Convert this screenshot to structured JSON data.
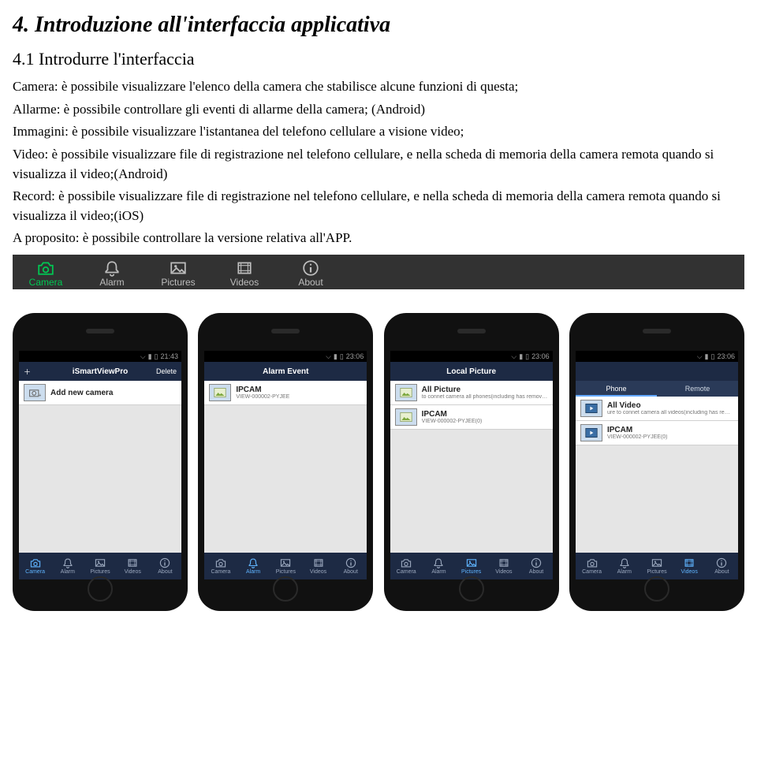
{
  "headings": {
    "h1": "4. Introduzione all'interfaccia applicativa",
    "h2": "4.1 Introdurre l'interfaccia"
  },
  "paragraphs": {
    "p1": "Camera: è possibile visualizzare l'elenco della camera che stabilisce alcune funzioni di questa;",
    "p2": "Allarme: è possibile controllare gli eventi di allarme della camera; (Android)",
    "p3": "Immagini: è possibile visualizzare l'istantanea del telefono cellulare a visione video;",
    "p4": "Video: è possibile visualizzare file di registrazione nel telefono cellulare, e nella scheda di memoria della camera remota quando si visualizza il video;(Android)",
    "p5": "Record: è possibile visualizzare file di registrazione nel telefono cellulare, e nella scheda di memoria della camera remota quando si visualizza il video;(iOS)",
    "p6": "A proposito: è possibile controllare la versione relativa all'APP."
  },
  "toolbar": {
    "items": [
      {
        "icon": "camera-icon",
        "label": "Camera",
        "active": true
      },
      {
        "icon": "bell-icon",
        "label": "Alarm",
        "active": false
      },
      {
        "icon": "image-icon",
        "label": "Pictures",
        "active": false
      },
      {
        "icon": "film-icon",
        "label": "Videos",
        "active": false
      },
      {
        "icon": "info-icon",
        "label": "About",
        "active": false
      }
    ]
  },
  "phones": [
    {
      "status_time": "21:43",
      "appbar": {
        "left": "＋",
        "center": "iSmartViewPro",
        "right": "Delete"
      },
      "tabs": null,
      "rows": [
        {
          "thumb": "camera-add",
          "t1": "Add new camera",
          "t2": ""
        }
      ],
      "bottomnav_active": 0
    },
    {
      "status_time": "23:06",
      "appbar": {
        "left": "",
        "center": "Alarm Event",
        "right": ""
      },
      "tabs": null,
      "rows": [
        {
          "thumb": "photo",
          "t1": "IPCAM",
          "t2": "VIEW-000002-PYJEE"
        }
      ],
      "bottomnav_active": 1
    },
    {
      "status_time": "23:06",
      "appbar": {
        "left": "",
        "center": "Local Picture",
        "right": ""
      },
      "tabs": null,
      "rows": [
        {
          "thumb": "photo",
          "t1": "All Picture",
          "t2": "to connet camera all phones(including has removed the :"
        },
        {
          "thumb": "photo",
          "t1": "IPCAM",
          "t2": "VIEW-000002-PYJEE(0)"
        }
      ],
      "bottomnav_active": 2
    },
    {
      "status_time": "23:06",
      "appbar": {
        "left": "",
        "center": "",
        "right": ""
      },
      "tabs": {
        "left": "Phone",
        "right": "Remote",
        "active": 0
      },
      "rows": [
        {
          "thumb": "video",
          "t1": "All Video",
          "t2": "ure to connet camera all videos(including has removed ti"
        },
        {
          "thumb": "video",
          "t1": "IPCAM",
          "t2": "VIEW-000002-PYJEE(0)"
        }
      ],
      "bottomnav_active": 3
    }
  ],
  "bottomnav_labels": [
    "Camera",
    "Alarm",
    "Pictures",
    "Videos",
    "About"
  ]
}
